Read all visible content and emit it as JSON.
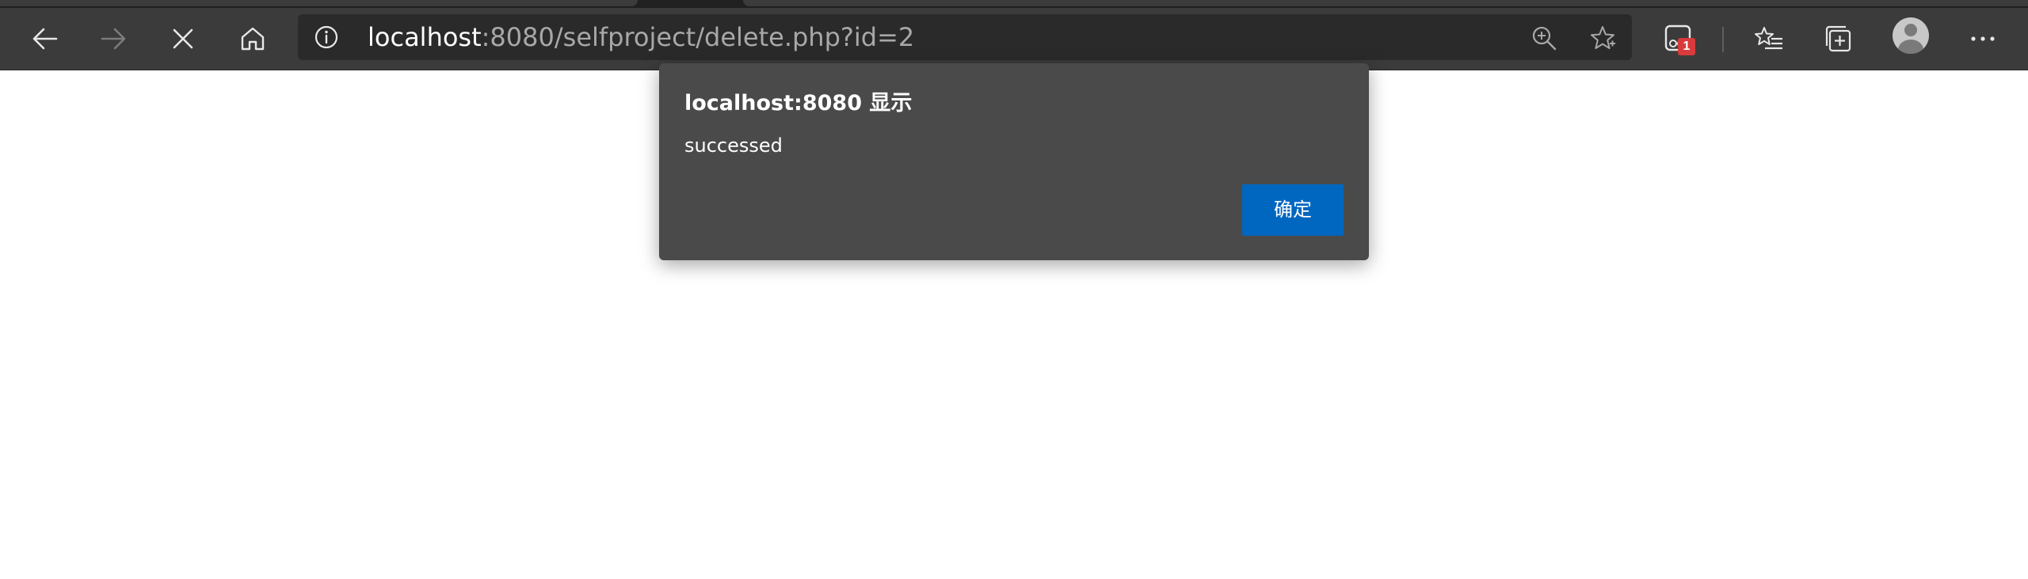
{
  "browser": {
    "address_bar": {
      "url_host": "localhost",
      "url_rest": ":8080/selfproject/delete.php?id=2"
    },
    "toolbar": {
      "back_icon": "arrow-left-icon",
      "forward_icon": "arrow-right-icon",
      "stop_icon": "close-icon",
      "home_icon": "home-icon",
      "zoom_icon": "zoom-in-icon",
      "favorite_icon": "star-icon",
      "extension_icon": "extension-icon",
      "extension_badge": "1",
      "favorites_list_icon": "favorites-list-icon",
      "collections_icon": "collections-icon",
      "profile_icon": "avatar-icon",
      "more_icon": "more-icon"
    },
    "colors": {
      "toolbar_bg": "#3b3b3b",
      "addressbar_bg": "#2a2a2a",
      "badge_red": "#d83b3b"
    }
  },
  "dialog": {
    "title": "localhost:8080 显示",
    "message": "successed",
    "ok_label": "确定",
    "colors": {
      "background": "#4a4a4a",
      "button": "#0067c0"
    }
  }
}
